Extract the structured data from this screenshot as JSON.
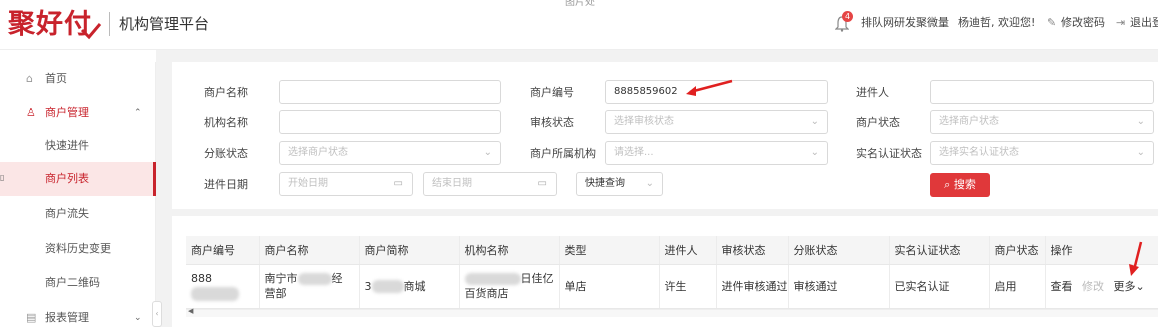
{
  "header": {
    "brand": "聚好付",
    "platform": "机构管理平台",
    "notification_count": "4",
    "team": "排队网研发聚微量",
    "welcome": "杨迪哲, 欢迎您!",
    "change_password": "修改密码",
    "logout": "退出登",
    "top_cut_text": "图片处"
  },
  "sidebar": {
    "home": "首页",
    "merchant_mgmt": "商户管理",
    "quick_entry": "快速进件",
    "merchant_list": "商户列表",
    "merchant_churn": "商户流失",
    "history_change": "资料历史变更",
    "merchant_qr": "商户二维码",
    "reports": "报表管理"
  },
  "filters": {
    "merchant_name_label": "商户名称",
    "merchant_no_label": "商户编号",
    "merchant_no_value": "8885859602",
    "applicant_label": "进件人",
    "org_name_label": "机构名称",
    "audit_status_label": "审核状态",
    "audit_status_placeholder": "选择审核状态",
    "merchant_status_label": "商户状态",
    "merchant_status_placeholder": "选择商户状态",
    "split_status_label": "分账状态",
    "split_status_placeholder": "选择商户状态",
    "belong_org_label": "商户所属机构",
    "belong_org_placeholder": "请选择...",
    "realname_label": "实名认证状态",
    "realname_placeholder": "选择实名认证状态",
    "date_label": "进件日期",
    "start_date": "开始日期",
    "end_date": "结束日期",
    "quick_query": "快捷查询",
    "search_button": "搜索"
  },
  "table": {
    "headers": [
      "商户编号",
      "商户名称",
      "商户简称",
      "机构名称",
      "类型",
      "进件人",
      "审核状态",
      "分账状态",
      "实名认证状态",
      "商户状态",
      "操作"
    ],
    "row": {
      "merchant_no": "888",
      "merchant_name_a": "南宁市",
      "merchant_name_b": "经",
      "merchant_name_c": "营部",
      "short_name_a": "3",
      "short_name_b": "商城",
      "org_name_a": "日佳亿",
      "org_name_b": "百货商店",
      "type": "单店",
      "applicant": "许生",
      "audit_status": "进件审核通过",
      "split_status": "审核通过",
      "realname_status": "已实名认证",
      "merchant_status": "启用",
      "op_view": "查看",
      "op_edit": "修改",
      "op_more": "更多"
    }
  },
  "colors": {
    "brand_red": "#c8232c",
    "search_btn": "#e0383a"
  }
}
